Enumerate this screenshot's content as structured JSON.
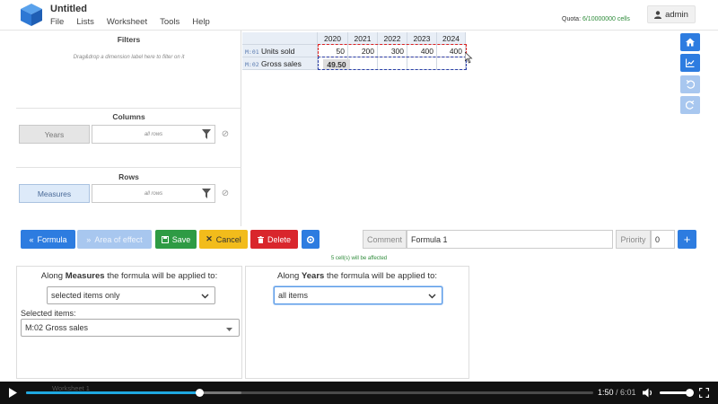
{
  "app": {
    "title": "Untitled",
    "menu": [
      "File",
      "Lists",
      "Worksheet",
      "Tools",
      "Help"
    ],
    "quota_label": "Quota:",
    "quota_value": "6/10000000 cells",
    "user": "admin"
  },
  "filters": {
    "title": "Filters",
    "hint": "Drag&drop a dimension label here to filter on it"
  },
  "columns": {
    "title": "Columns",
    "dimension": "Years",
    "filter_text": "all rows"
  },
  "rows": {
    "title": "Rows",
    "dimension": "Measures",
    "filter_text": "all rows"
  },
  "grid": {
    "years": [
      "2020",
      "2021",
      "2022",
      "2023",
      "2024"
    ],
    "rows": [
      {
        "code": "M:01",
        "name": "Units sold",
        "values": [
          "50",
          "200",
          "300",
          "400",
          "400"
        ]
      },
      {
        "code": "M:02",
        "name": "Gross sales",
        "values": [
          "49.50",
          "",
          "",
          "",
          ""
        ]
      }
    ]
  },
  "formula_bar": {
    "formula_button": "Formula",
    "area_button": "Area of effect",
    "save_button": "Save",
    "cancel_button": "Cancel",
    "delete_button": "Delete",
    "comment_label": "Comment",
    "comment_value": "Formula 1",
    "priority_label": "Priority",
    "priority_value": "0",
    "affected_text": "5 cell(s) will be affected"
  },
  "measures_panel": {
    "title_prefix": "Along",
    "title_dim": "Measures",
    "title_suffix": "the formula will be applied to:",
    "select_value": "selected items only",
    "selected_label": "Selected items:",
    "selected_value": "M:02 Gross sales"
  },
  "years_panel": {
    "title_prefix": "Along",
    "title_dim": "Years",
    "title_suffix": "the formula will be applied to:",
    "select_value": "all items"
  },
  "video": {
    "worksheet_tab": "Worksheet 1",
    "current_time": "1:50",
    "separator": " / ",
    "duration": "6:01",
    "progress_fraction": 0.305
  },
  "colors": {
    "primary": "#2d7ce0",
    "success": "#2e9b44",
    "warning": "#f2bc1b",
    "danger": "#d9262c",
    "quota": "#2e8b3a"
  }
}
